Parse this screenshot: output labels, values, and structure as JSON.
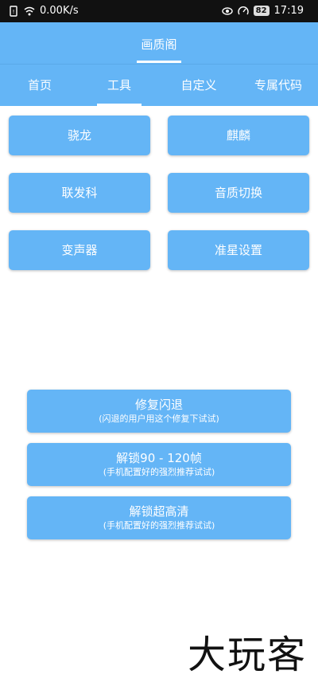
{
  "status_bar": {
    "network_speed": "0.00K/s",
    "battery": "82",
    "time": "17:19",
    "icons": [
      "sim-icon",
      "wifi-icon",
      "eye-icon",
      "speed-gauge-icon",
      "battery-icon"
    ]
  },
  "header": {
    "title": "画质阁"
  },
  "tabs": [
    {
      "label": "首页",
      "active": false
    },
    {
      "label": "工具",
      "active": true
    },
    {
      "label": "自定义",
      "active": false
    },
    {
      "label": "专属代码",
      "active": false
    }
  ],
  "tools": {
    "snapdragon": "骁龙",
    "kirin": "麒麟",
    "mediatek": "联发科",
    "sound_quality_switch": "音质切换",
    "voice_changer": "变声器",
    "crosshair_settings": "准星设置"
  },
  "actions": {
    "fix_crash": {
      "title": "修复闪退",
      "subtitle": "(闪退的用户用这个修复下试试)"
    },
    "unlock_fps": {
      "title": "解锁90 - 120帧",
      "subtitle": "(手机配置好的强烈推荐试试)"
    },
    "unlock_hd": {
      "title": "解锁超高清",
      "subtitle": "(手机配置好的强烈推荐试试)"
    }
  },
  "watermark": "大玩客",
  "colors": {
    "primary": "#64b5f6",
    "status_bar": "#111111",
    "text_on_primary": "#ffffff"
  }
}
